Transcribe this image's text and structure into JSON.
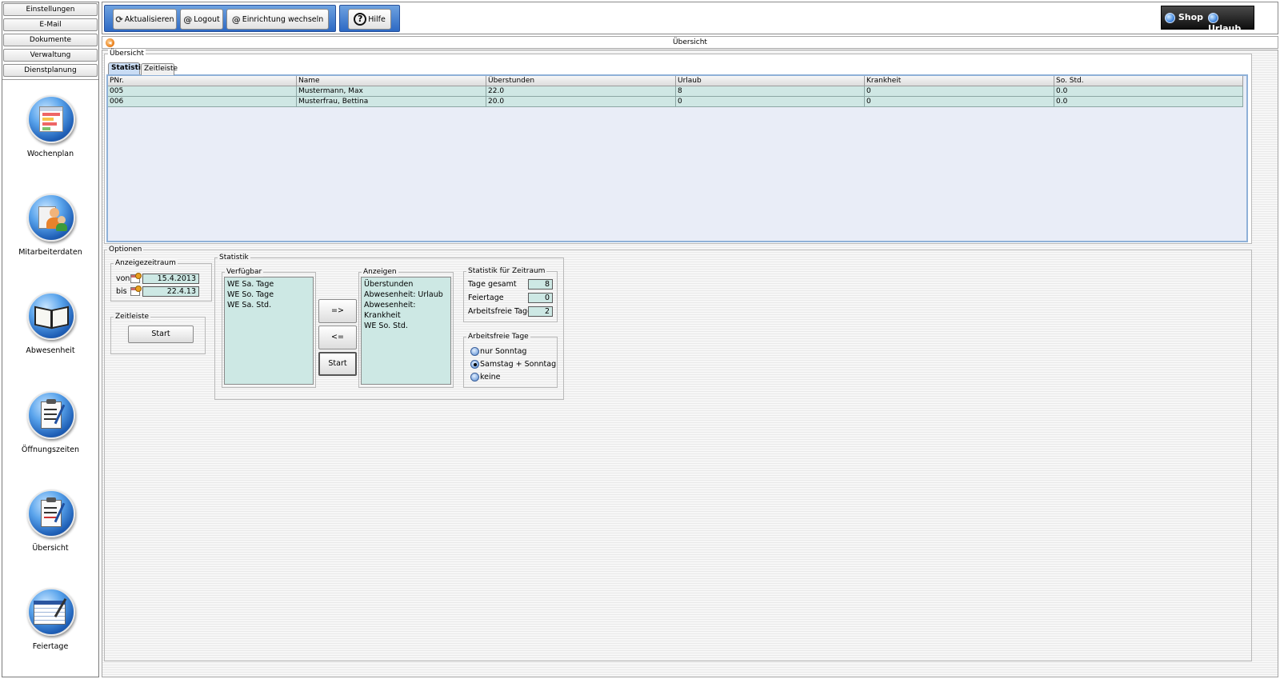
{
  "sidebar": {
    "menu": [
      "Einstellungen",
      "E-Mail",
      "Dokumente",
      "Verwaltung",
      "Dienstplanung"
    ],
    "nav": [
      {
        "label": "Wochenplan",
        "icon": "calendar-icon"
      },
      {
        "label": "Mitarbeiterdaten",
        "icon": "employees-icon"
      },
      {
        "label": "Abwesenheit",
        "icon": "book-icon"
      },
      {
        "label": "Öffnungszeiten",
        "icon": "clipboard-icon"
      },
      {
        "label": "Übersicht",
        "icon": "clipboard-checklist-icon"
      },
      {
        "label": "Feiertage",
        "icon": "spreadsheet-icon"
      }
    ]
  },
  "toolbar": {
    "refresh": "Aktualisieren",
    "logout": "Logout",
    "switch": "Einrichtung wechseln",
    "help": "Hilfe",
    "shop": "Shop",
    "urlaub": "Urlaub"
  },
  "titlebar": {
    "title": "Übersicht"
  },
  "overview": {
    "legend": "Übersicht",
    "tabs": [
      "Statistik",
      "Zeitleiste"
    ],
    "columns": [
      "PNr.",
      "Name",
      "Überstunden",
      "Urlaub",
      "Krankheit",
      "So. Std."
    ],
    "rows": [
      [
        "005",
        "Mustermann, Max",
        "22.0",
        "8",
        "0",
        "0.0"
      ],
      [
        "006",
        "Musterfrau, Bettina",
        "20.0",
        "0",
        "0",
        "0.0"
      ]
    ]
  },
  "options": {
    "legend": "Optionen",
    "period": {
      "legend": "Anzeigezeitraum",
      "from_label": "von",
      "from": "15.4.2013",
      "to_label": "bis",
      "to": "22.4.13"
    },
    "timeline": {
      "legend": "Zeitleiste",
      "start": "Start"
    },
    "statistik": {
      "legend": "Statistik",
      "available_legend": "Verfügbar",
      "available": [
        "WE Sa. Tage",
        "WE So. Tage",
        "WE Sa. Std."
      ],
      "add": "=>",
      "remove": "<=",
      "start": "Start",
      "display_legend": "Anzeigen",
      "display": [
        "Überstunden",
        "Abwesenheit: Urlaub",
        "Abwesenheit: Krankheit",
        "WE So. Std."
      ]
    },
    "period_stats": {
      "legend": "Statistik für Zeitraum",
      "total_label": "Tage gesamt",
      "total": "8",
      "holidays_label": "Feiertage",
      "holidays": "0",
      "free_label": "Arbeitsfreie Tage",
      "free": "2"
    },
    "free_days": {
      "legend": "Arbeitsfreie Tage",
      "options": [
        "nur Sonntag",
        "Samstag  + Sonntag",
        "keine"
      ],
      "selected": 1
    }
  }
}
